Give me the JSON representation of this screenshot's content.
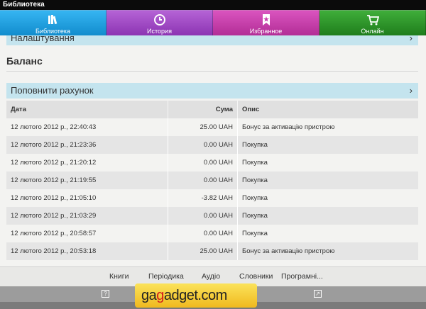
{
  "window": {
    "title": "Библиотека"
  },
  "nav": {
    "tabs": [
      {
        "label": "Библиотека",
        "icon": "books-icon",
        "color": "#1a9ee0"
      },
      {
        "label": "История",
        "icon": "clock-icon",
        "color": "#a04cc6"
      },
      {
        "label": "Избранное",
        "icon": "bookmark-star-icon",
        "color": "#c63fac"
      },
      {
        "label": "Онлайн",
        "icon": "shopping-cart-icon",
        "color": "#2d932a"
      }
    ]
  },
  "settings": {
    "label": "Налаштування"
  },
  "balance": {
    "heading": "Баланс",
    "topup_label": "Поповнити рахунок",
    "columns": {
      "date": "Дата",
      "amount": "Сума",
      "description": "Опис"
    },
    "rows": [
      {
        "date": "12 лютого 2012 р., 22:40:43",
        "amount": "25.00 UAH",
        "description": "Бонус за активацію пристрою"
      },
      {
        "date": "12 лютого 2012 р., 21:23:36",
        "amount": "0.00 UAH",
        "description": "Покупка"
      },
      {
        "date": "12 лютого 2012 р., 21:20:12",
        "amount": "0.00 UAH",
        "description": "Покупка"
      },
      {
        "date": "12 лютого 2012 р., 21:19:55",
        "amount": "0.00 UAH",
        "description": "Покупка"
      },
      {
        "date": "12 лютого 2012 р., 21:05:10",
        "amount": "-3.82 UAH",
        "description": "Покупка"
      },
      {
        "date": "12 лютого 2012 р., 21:03:29",
        "amount": "0.00 UAH",
        "description": "Покупка"
      },
      {
        "date": "12 лютого 2012 р., 20:58:57",
        "amount": "0.00 UAH",
        "description": "Покупка"
      },
      {
        "date": "12 лютого 2012 р., 20:53:18",
        "amount": "25.00 UAH",
        "description": "Бонус за активацію пристрою"
      }
    ]
  },
  "categories": [
    "Книги",
    "Періодика",
    "Аудіо",
    "Словники",
    "Програмні..."
  ],
  "watermark": {
    "prefix": "ga",
    "highlight": "g",
    "suffix": "adget.com"
  }
}
